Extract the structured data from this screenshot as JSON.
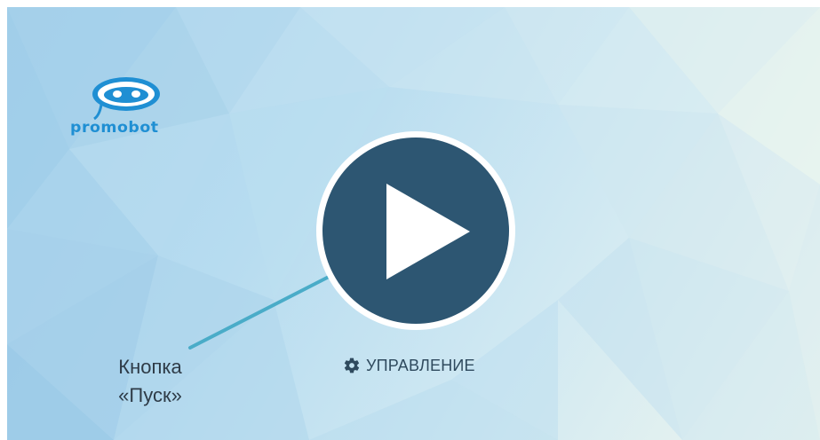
{
  "logo": {
    "text": "promobot",
    "color": "#1f8fd3"
  },
  "play_button": {
    "icon": "play-icon",
    "fill_color": "#2d5672",
    "ring_color": "#ffffff"
  },
  "control": {
    "icon": "gear-icon",
    "label": "УПРАВЛЕНИЕ"
  },
  "callout": {
    "line1": "Кнопка",
    "line2": "«Пуск»",
    "line_color": "#4aacc8"
  }
}
